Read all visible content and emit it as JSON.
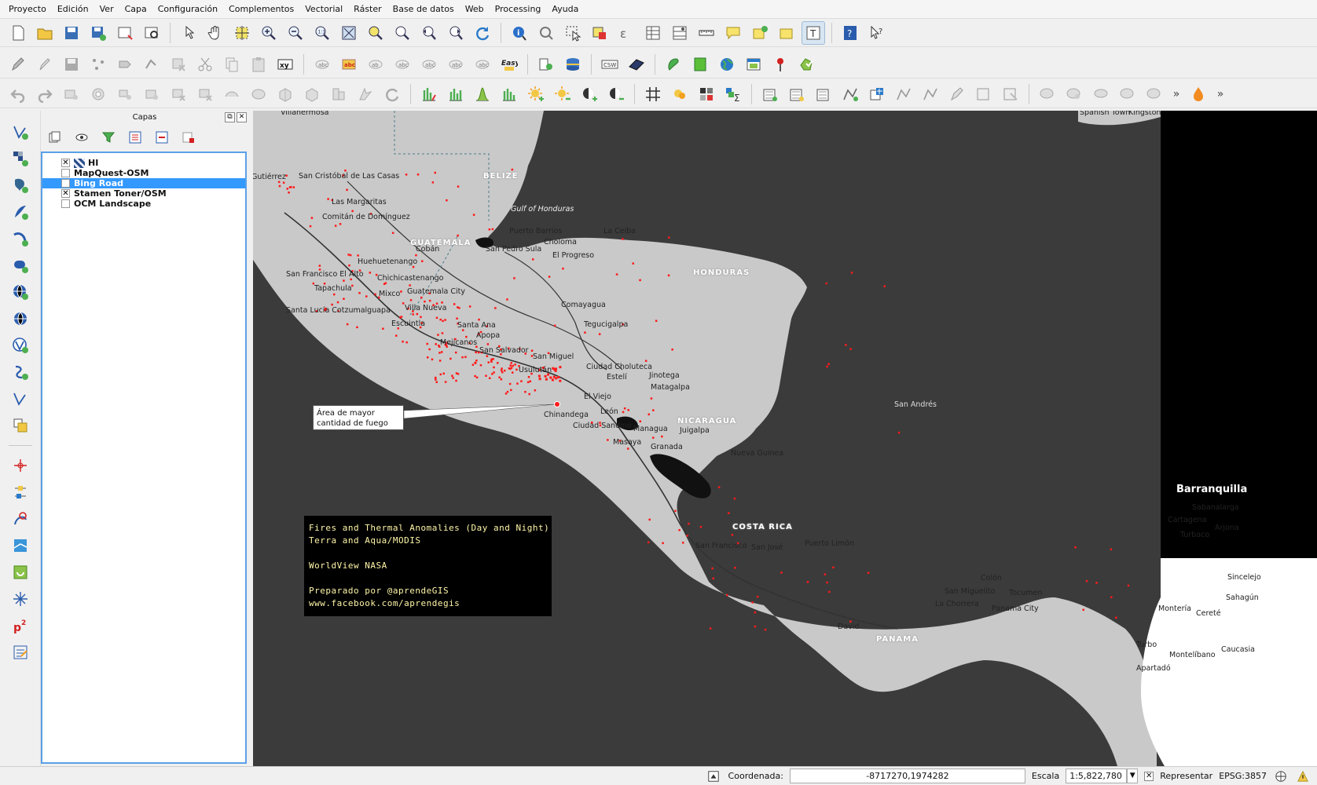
{
  "menu": [
    "Proyecto",
    "Edición",
    "Ver",
    "Capa",
    "Configuración",
    "Complementos",
    "Vectorial",
    "Ráster",
    "Base de datos",
    "Web",
    "Processing",
    "Ayuda"
  ],
  "layers_panel": {
    "title": "Capas",
    "layers": [
      {
        "name": "HI",
        "checked": true,
        "icon": "raster-layer-icon"
      },
      {
        "name": "MapQuest-OSM",
        "checked": false
      },
      {
        "name": "Bing Road",
        "checked": false,
        "selected": true
      },
      {
        "name": "Stamen Toner/OSM",
        "checked": true
      },
      {
        "name": "OCM Landscape",
        "checked": false
      }
    ]
  },
  "map": {
    "callout": [
      "Área de mayor",
      "cantidad de fuego"
    ],
    "info_box": "Fires and Thermal Anomalies (Day and Night)\nTerra and Aqua/MODIS\n\nWorldView NASA\n\nPreparado por @aprendeGIS\nwww.facebook.com/aprendegis",
    "countries": [
      "BELIZE",
      "GUATEMALA",
      "HONDURAS",
      "NICARAGUA",
      "COSTA RICA",
      "PANAMA"
    ],
    "cities": [
      "Villahermosa",
      "Gutiérrez",
      "San Cristóbal de Las Casas",
      "Las Margaritas",
      "Comitán de Domínguez",
      "Cobán",
      "Puerto Barrios",
      "La Ceiba",
      "Gulf of Honduras",
      "Choloma",
      "San Pedro Sula",
      "El Progreso",
      "Huehuetenango",
      "San Francisco El Alto",
      "Chichicastenango",
      "Tapachula",
      "Mixco",
      "Guatemala City",
      "Villa Nueva",
      "Comayagua",
      "Santa Lucía Cotzumalguapa",
      "Escuintla",
      "Tegucigalpa",
      "Santa Ana",
      "Apopa",
      "Mejicanos",
      "San Salvador",
      "San Miguel",
      "Usulután",
      "Ciudad Choluteca",
      "Estelí",
      "Jinotega",
      "Matagalpa",
      "El Viejo",
      "Chinandega",
      "León",
      "Ciudad Sandino",
      "Managua",
      "Juigalpa",
      "Masaya",
      "Granada",
      "Nueva Guinea",
      "San Andrés",
      "San Francisco",
      "San José",
      "Puerto Limón",
      "Colón",
      "San Miguelito",
      "Tocumen",
      "La Chorrera",
      "Panama City",
      "David",
      "Spanish Town",
      "Kingston",
      "Barranquilla",
      "Sabanalarga",
      "Cartagena",
      "Turbaco",
      "Arjona",
      "Sincelejo",
      "Sahagún",
      "Montería",
      "Cereté",
      "Turbo",
      "Montelíbano",
      "Apartadó",
      "Caucasia"
    ]
  },
  "statusbar": {
    "coord_label": "Coordenada:",
    "coord_value": "-8717270,1974282",
    "scale_label": "Escala",
    "scale_value": "1:5,822,780",
    "render_label": "Representar",
    "crs": "EPSG:3857"
  },
  "colors": {
    "fire_points": "#ff1a1a",
    "land": "#c9c9c9",
    "water": "#3b3b3b",
    "selection": "#3399ff"
  }
}
